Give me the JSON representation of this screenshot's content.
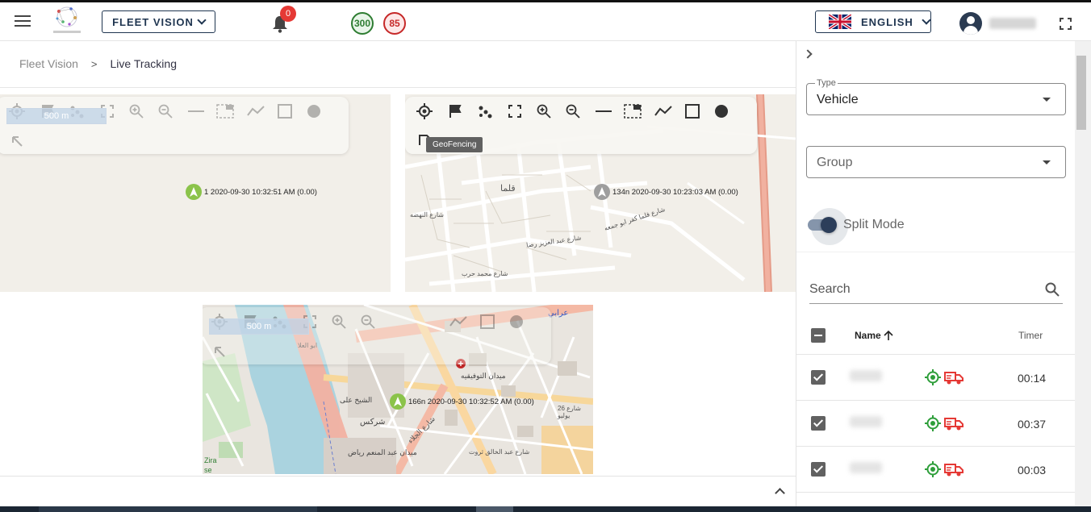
{
  "header": {
    "menu_icon": "hamburger-menu-icon",
    "logo_icon": "network-logo-icon",
    "fleet_button_label": "FLEET VISION",
    "notification_count": "0",
    "online_count": "300",
    "offline_count": "85",
    "language_label": "ENGLISH",
    "language_flag_icon": "uk-flag-icon",
    "fullscreen_icon": "fullscreen-icon"
  },
  "breadcrumb": {
    "root": "Fleet Vision",
    "separator": ">",
    "current": "Live Tracking"
  },
  "maps": {
    "scale_label": "500 m",
    "tooltip": "GeoFencing",
    "map1_marker": "1 2020-09-30 10:32:51 AM (0.00)",
    "map2_marker": "134n 2020-09-30 10:23:03 AM (0.00)",
    "map3_marker": "166n 2020-09-30 10:32:52 AM (0.00)",
    "map2_labels": [
      "قلما",
      "شارع قلما كفر ابو جمعه",
      "شارع عبد العزيز رضا",
      "شارع محمد حرب",
      "شارع النهضه"
    ],
    "map3_labels": [
      "ميدان التوفيقيه",
      "الشيخ على",
      "شركس",
      "ميدان عبد المنعم رياض",
      "عرابي",
      "ابو العلا",
      "شارع عبد الخالق ثروت",
      "شارع 26 يوليو",
      "شارع الجلاء",
      "Zira",
      "se"
    ]
  },
  "panel": {
    "type_label": "Type",
    "type_value": "Vehicle",
    "group_placeholder": "Group",
    "split_mode_label": "Split Mode",
    "split_mode_on": true,
    "search_placeholder": "Search",
    "col_name": "Name",
    "col_timer": "Timer",
    "rows": [
      {
        "timer": "00:14",
        "checked": true
      },
      {
        "timer": "00:37",
        "checked": true
      },
      {
        "timer": "00:03",
        "checked": true
      }
    ]
  },
  "colors": {
    "brand_navy": "#1f3550",
    "online_green": "#2e7d32",
    "offline_red": "#c62828",
    "badge_red": "#e53935",
    "marker_green": "#8bc34a",
    "status_red": "#e53935"
  }
}
